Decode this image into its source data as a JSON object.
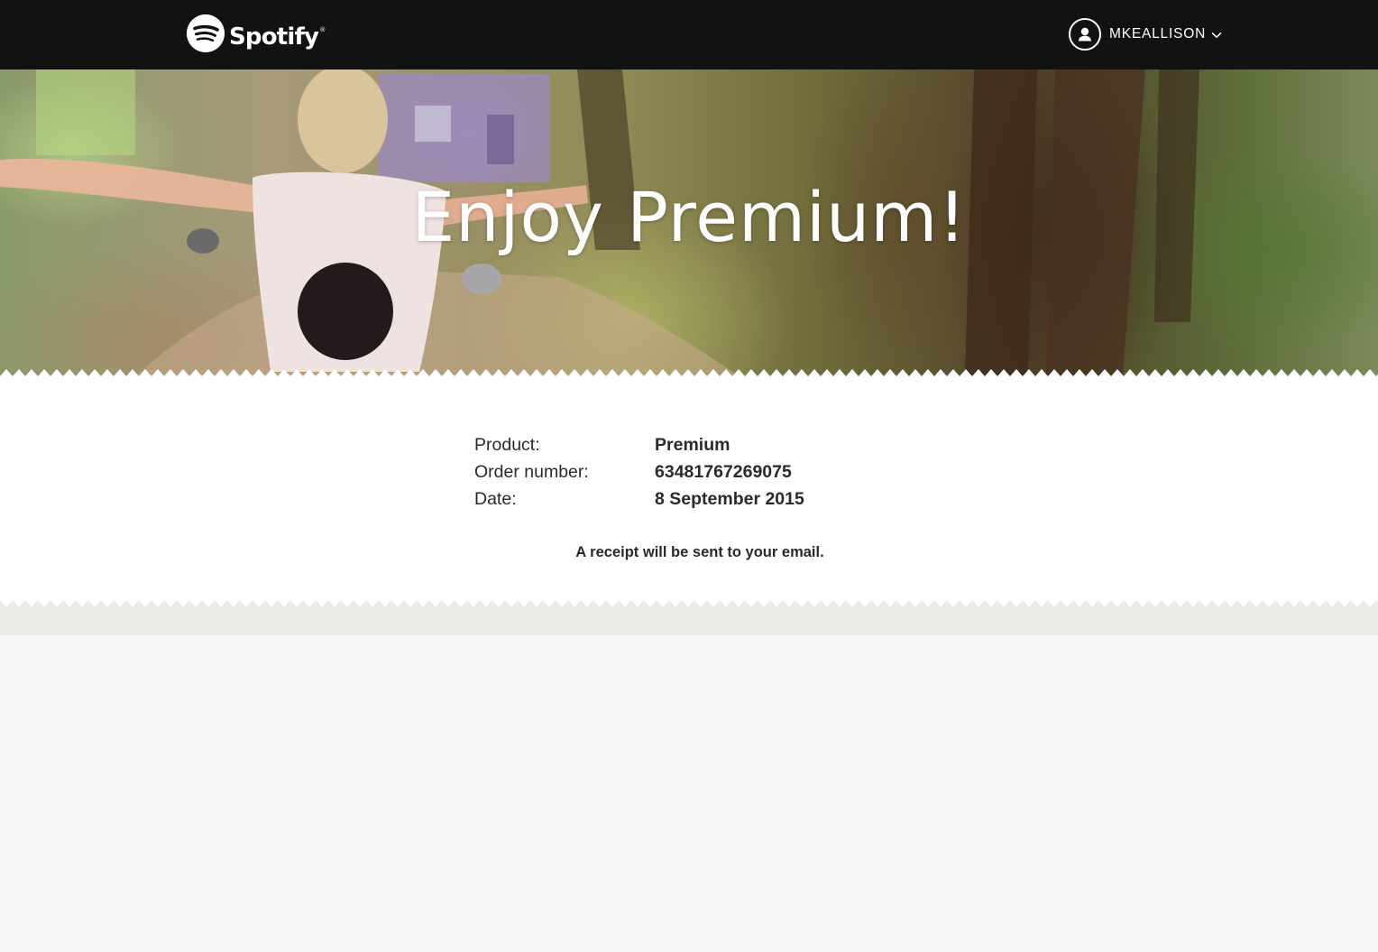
{
  "header": {
    "brand": "Spotify",
    "brand_mark": "®",
    "username": "MKEALLISON",
    "icons": {
      "logo": "spotify-logo-icon",
      "user": "user-icon",
      "dropdown": "chevron-down-icon"
    },
    "colors": {
      "background": "#121212",
      "foreground": "#ffffff"
    }
  },
  "hero": {
    "title": "Enjoy Premium!"
  },
  "order": {
    "rows": [
      {
        "label": "Product:",
        "value": "Premium"
      },
      {
        "label": "Order number:",
        "value": "63481767269075"
      },
      {
        "label": "Date:",
        "value": "8 September 2015"
      }
    ],
    "receipt_note": "A receipt will be sent to your email."
  }
}
